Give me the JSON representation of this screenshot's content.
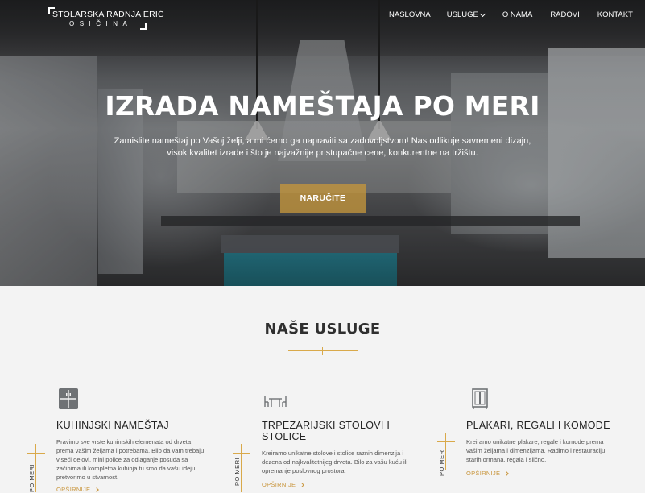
{
  "logo": {
    "line1": "STOLARSKA RADNJA ERIĆ",
    "line2": "OSIČINA"
  },
  "nav": {
    "items": [
      "NASLOVNA",
      "USLUGE",
      "O NAMA",
      "RADOVI",
      "KONTAKT"
    ]
  },
  "hero": {
    "title": "IZRADA NAMEŠTAJA PO MERI",
    "subtitle": "Zamislite nameštaj po Vašoj želji, a mi ćemo ga napraviti sa zadovoljstvom! Nas odlikuje savremeni dizajn, visok kvalitet izrade i što je najvažnije pristupačne cene, konkurentne na tržištu.",
    "button": "NARUČITE"
  },
  "services": {
    "title": "NAŠE USLUGE",
    "vertical_label": "PO MERI",
    "items": [
      {
        "icon": "cabinet-icon",
        "title": "KUHINJSKI NAMEŠTAJ",
        "text": "Pravimo sve vrste kuhinjskih elemenata od drveta prema vašim željama i potrebama. Bilo da vam trebaju viseći delovi, mini police za odlaganje posuđa sa začinima ili kompletna kuhinja tu smo da vašu ideju pretvorimo u stvarnost.",
        "more": "OPŠIRNIJE"
      },
      {
        "icon": "table-chairs-icon",
        "title": "TRPEZARIJSKI STOLOVI I STOLICE",
        "text": "Kreiramo unikatne stolove i stolice raznih dimenzija i dezena od najkvalitetnijeg drveta. Bilo za vašu kuću ili opremanje poslovnog prostora.",
        "more": "OPŠIRNIJE"
      },
      {
        "icon": "wardrobe-icon",
        "title": "PLAKARI, REGALI I KOMODE",
        "text": "Kreiramo unikatne plakare, regale i komode prema vašim željama i dimenzijama. Radimo i restauraciju starih ormana, regala i slično.",
        "more": "OPŠIRNIJE"
      }
    ]
  },
  "colors": {
    "accent": "#c9963d",
    "button_bg": "#c4963c",
    "section_bg": "#f3f3f3"
  }
}
